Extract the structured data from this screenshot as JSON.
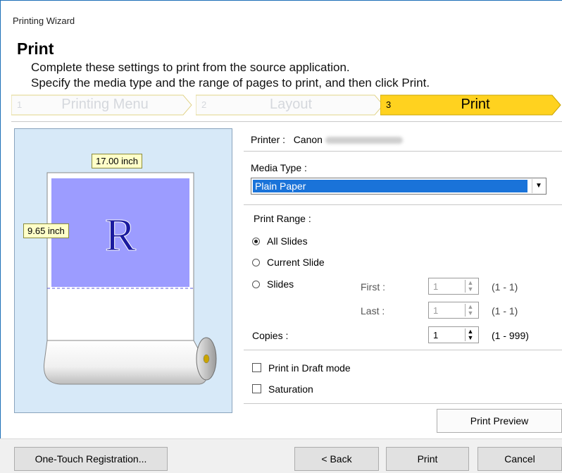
{
  "window": {
    "title": "Printing Wizard"
  },
  "page": {
    "heading": "Print",
    "description_line1": "Complete these settings to print from the source application.",
    "description_line2": "Specify the media type and the range of pages to print, and then click Print."
  },
  "steps": [
    {
      "number": "1",
      "label": "Printing Menu",
      "active": false
    },
    {
      "number": "2",
      "label": "Layout",
      "active": false
    },
    {
      "number": "3",
      "label": "Print",
      "active": true
    }
  ],
  "preview": {
    "width_label": "17.00 inch",
    "height_label": "9.65 inch",
    "sample_glyph": "R"
  },
  "settings": {
    "printer_label": "Printer :",
    "printer_name": "Canon",
    "media_type_label": "Media Type :",
    "media_type_value": "Plain Paper",
    "print_range_label": "Print Range :",
    "radio_all": "All Slides",
    "radio_current": "Current Slide",
    "radio_slides": "Slides",
    "selected_range": "All Slides",
    "first_label": "First :",
    "first_value": "1",
    "first_range": "(1 - 1)",
    "last_label": "Last :",
    "last_value": "1",
    "last_range": "(1 - 1)",
    "copies_label": "Copies :",
    "copies_value": "1",
    "copies_range": "(1 - 999)",
    "draft_mode_label": "Print in Draft mode",
    "saturation_label": "Saturation"
  },
  "buttons": {
    "print_preview": "Print Preview",
    "one_touch": "One-Touch Registration...",
    "back": "< Back",
    "print": "Print",
    "cancel": "Cancel"
  },
  "colors": {
    "active_step": "#ffd21f",
    "selection": "#1a73d9",
    "preview_bg": "#d7e9f8",
    "paper_print_area": "#9c9cff",
    "tag_bg": "#ffffc8"
  }
}
